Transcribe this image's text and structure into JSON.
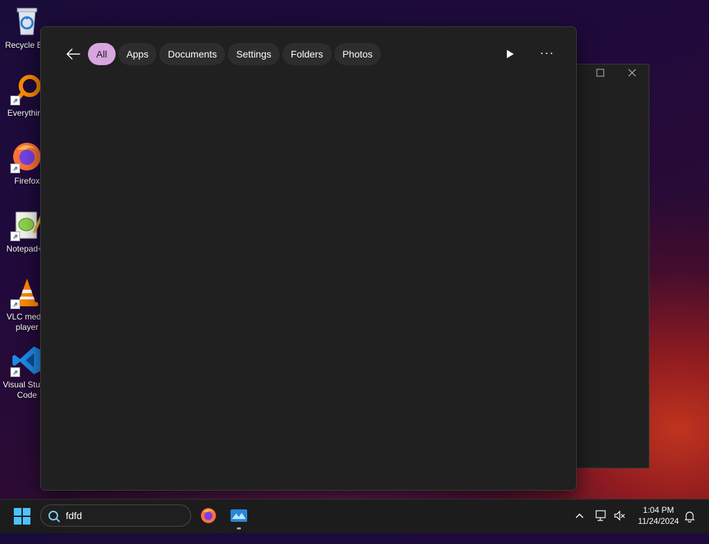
{
  "desktop": {
    "icons": [
      {
        "label": "Recycle Bin",
        "icon": "recycle-bin-icon"
      },
      {
        "label": "Everything",
        "icon": "everything-icon"
      },
      {
        "label": "Firefox",
        "icon": "firefox-icon"
      },
      {
        "label": "Notepad++",
        "icon": "notepad-plus-plus-icon"
      },
      {
        "label": "VLC media player",
        "icon": "vlc-icon"
      },
      {
        "label": "Visual Studio Code",
        "icon": "vscode-icon"
      }
    ]
  },
  "search_panel": {
    "filters": [
      {
        "label": "All",
        "active": true
      },
      {
        "label": "Apps",
        "active": false
      },
      {
        "label": "Documents",
        "active": false
      },
      {
        "label": "Settings",
        "active": false
      },
      {
        "label": "Folders",
        "active": false
      },
      {
        "label": "Photos",
        "active": false
      }
    ],
    "more_label": "···"
  },
  "taskbar": {
    "search_query": "fdfd",
    "time": "1:04 PM",
    "date": "11/24/2024"
  },
  "colors": {
    "accent_chip": "#d7a6de",
    "panel_bg": "#202020",
    "taskbar_bg": "#1c1c1c"
  }
}
